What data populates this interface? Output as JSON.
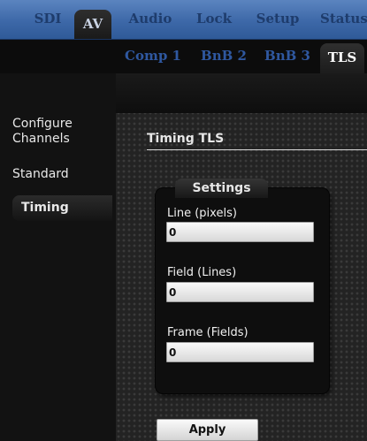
{
  "top_tabs": [
    {
      "label": "SDI",
      "active": false
    },
    {
      "label": "AV",
      "active": true
    },
    {
      "label": "Audio",
      "active": false
    },
    {
      "label": "Lock",
      "active": false
    },
    {
      "label": "Setup",
      "active": false
    },
    {
      "label": "Status",
      "active": false
    }
  ],
  "sub_tabs": [
    {
      "label": "Comp 1",
      "active": false
    },
    {
      "label": "BnB 2",
      "active": false
    },
    {
      "label": "BnB 3",
      "active": false
    },
    {
      "label": "TLS",
      "active": true
    }
  ],
  "sidebar": {
    "items": [
      {
        "label": "Configure\nChannels",
        "active": false
      },
      {
        "label": "Standard",
        "active": false
      },
      {
        "label": "Timing",
        "active": true
      }
    ]
  },
  "main": {
    "section_title": "Timing TLS",
    "panel_title": "Settings",
    "fields": [
      {
        "label": "Line (pixels)",
        "value": "0"
      },
      {
        "label": "Field (Lines)",
        "value": "0"
      },
      {
        "label": "Frame (Fields)",
        "value": "0"
      }
    ],
    "apply_label": "Apply"
  },
  "colors": {
    "top_bar": "#3d68a8",
    "sub_tab_text": "#2f58a0",
    "background": "#111111"
  }
}
